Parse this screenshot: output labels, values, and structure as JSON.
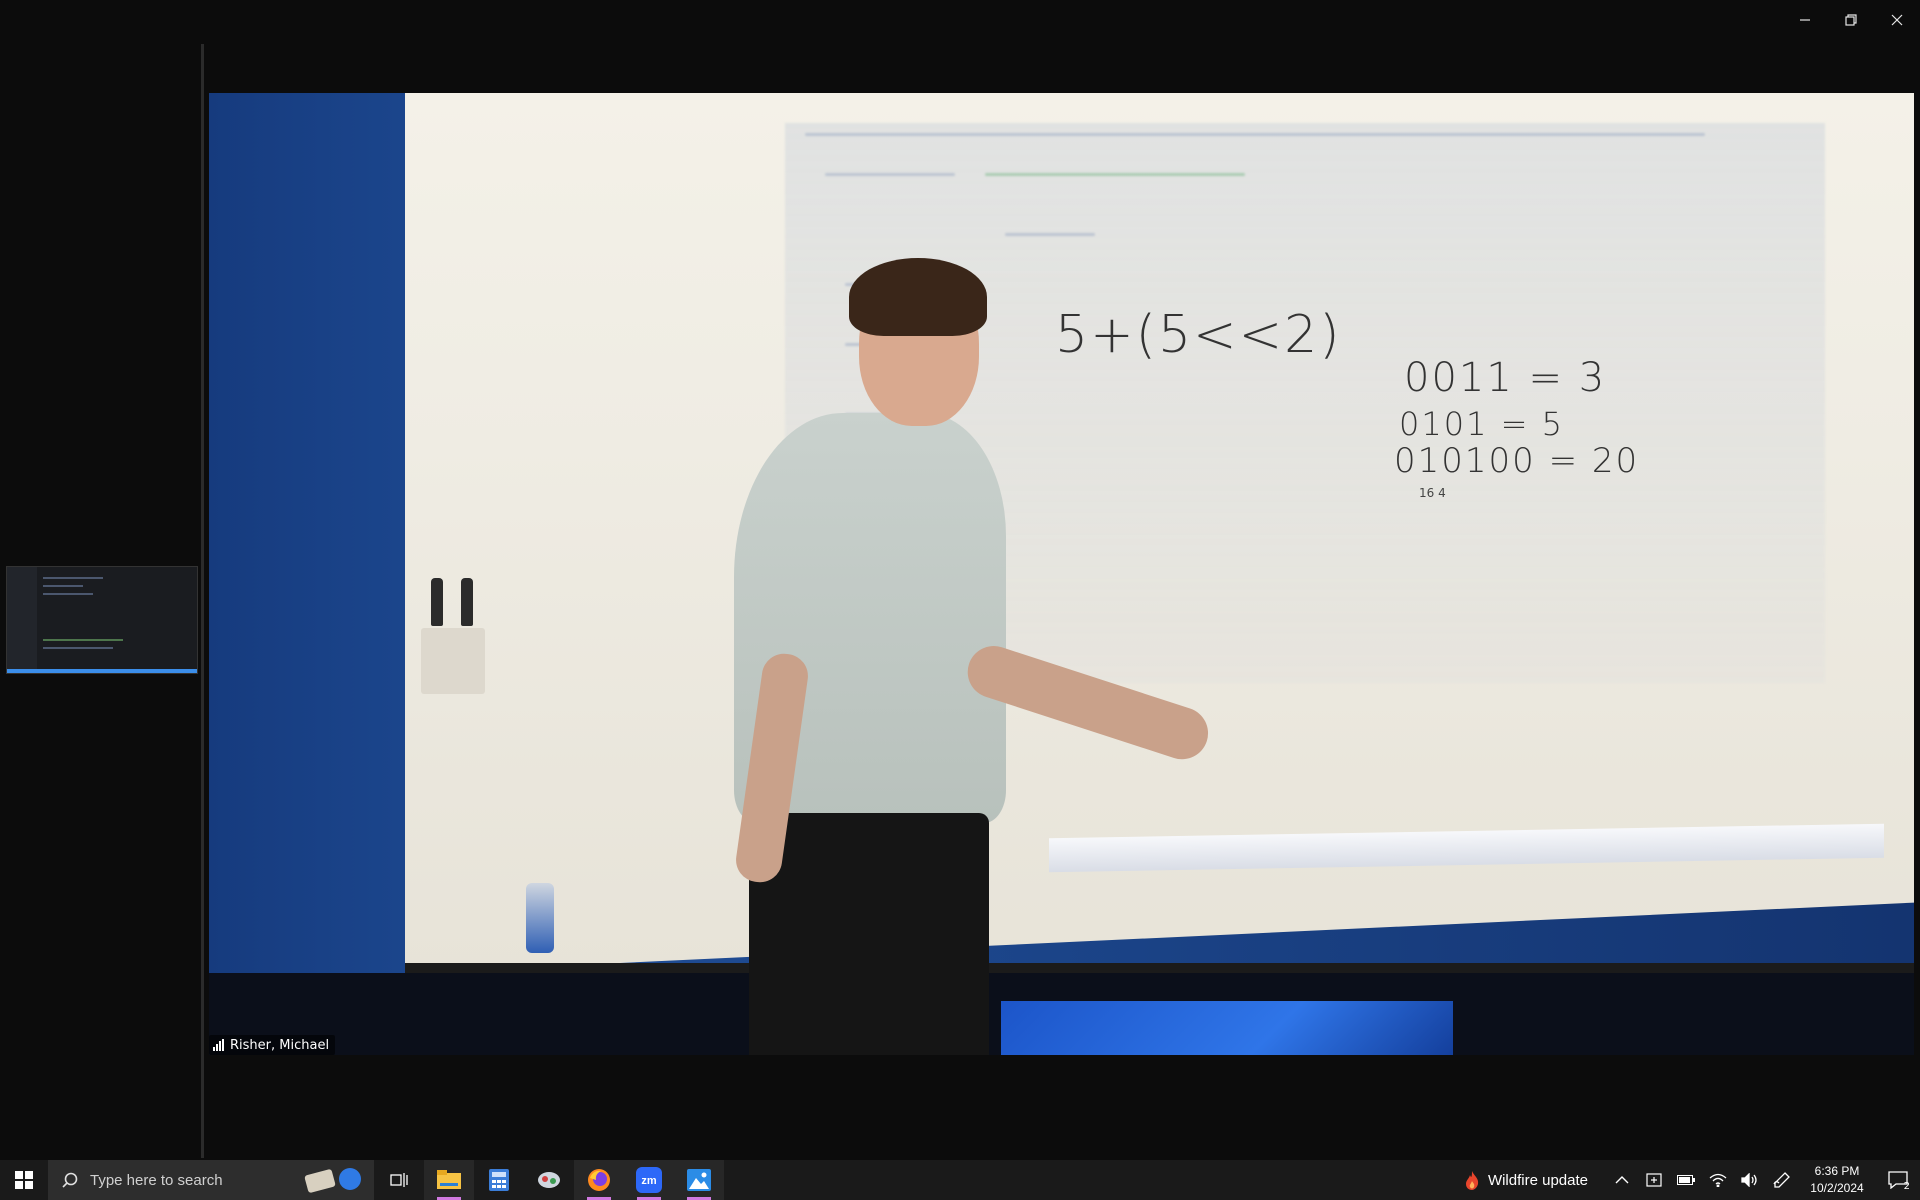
{
  "window": {
    "controls": [
      "minimize-icon",
      "restore-icon",
      "close-icon"
    ]
  },
  "video": {
    "participant_name": "Risher, Michael",
    "whiteboard": {
      "expression": "5+(5<<2)",
      "line1": "0011 = 3",
      "line2": "0101 = 5",
      "line3": "010100 = 20",
      "line3_sub": "16   4"
    }
  },
  "taskbar": {
    "search_placeholder": "Type here to search",
    "apps": [
      "task-view-icon",
      "file-explorer-icon",
      "calculator-icon",
      "app-icon",
      "firefox-icon",
      "zoom-icon",
      "photos-icon"
    ],
    "wildfire_label": "Wildfire update",
    "time": "6:36 PM",
    "date": "10/2/2024",
    "notification_count": "2",
    "accent": "#d079e0"
  }
}
